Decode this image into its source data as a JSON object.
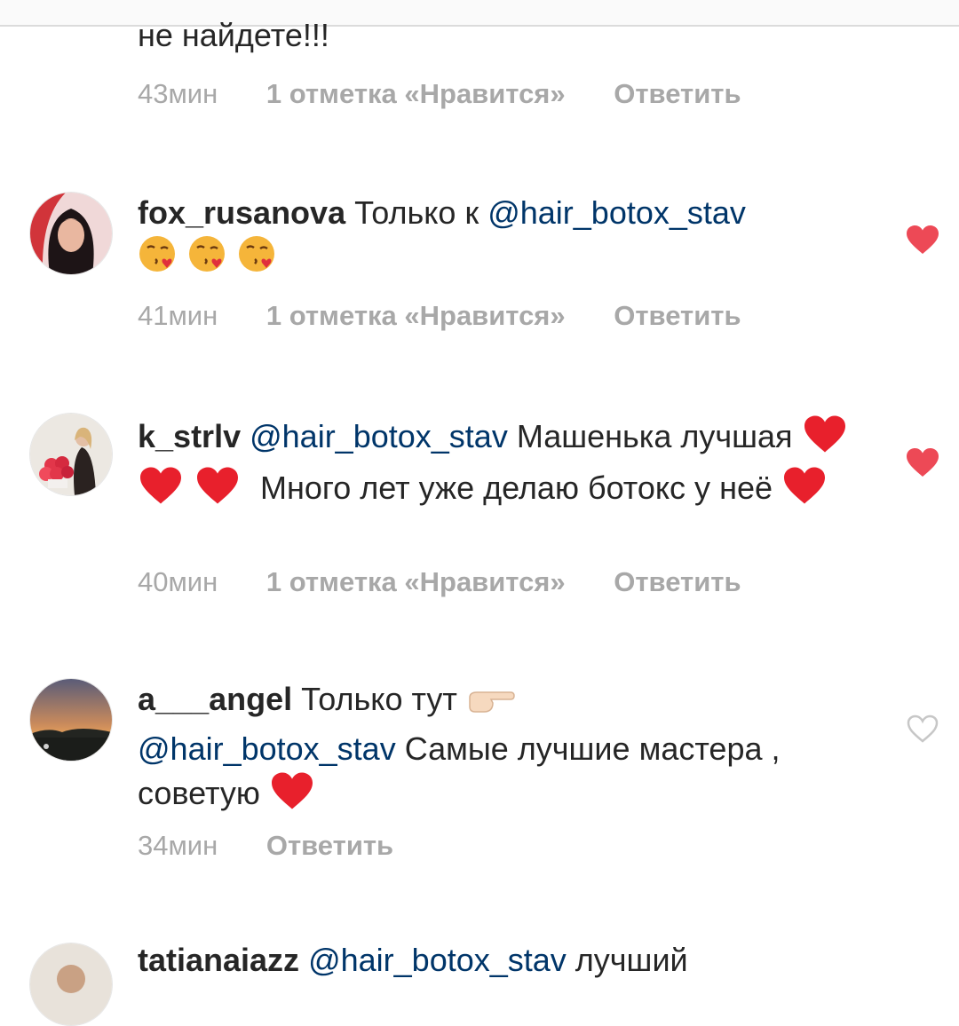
{
  "colors": {
    "mention": "#003569",
    "meta": "#a8a8a8",
    "liked_heart": "#ed4956"
  },
  "partial_comment": {
    "text": "не найдете!!!",
    "time": "43мин",
    "likes": "1 отметка «Нравится»",
    "reply": "Ответить"
  },
  "comments": [
    {
      "username": "fox_rusanova",
      "text_before": " Только к ",
      "mention": "@hair_botox_stav",
      "emojis": [
        "kissing-heart-emoji",
        "kissing-heart-emoji",
        "kissing-heart-emoji"
      ],
      "time": "41мин",
      "likes": "1 отметка «Нравится»",
      "reply": "Ответить",
      "liked": true
    },
    {
      "username": "k_strlv",
      "mention": "@hair_botox_stav",
      "text_1": " Машенька лучшая ",
      "text_2": " Много лет уже делаю ботокс у неё ",
      "emojis": [
        "red-heart-emoji",
        "red-heart-emoji",
        "red-heart-emoji",
        "red-heart-emoji"
      ],
      "time": "40мин",
      "likes": "1 отметка «Нравится»",
      "reply": "Ответить",
      "liked": true
    },
    {
      "username": "a___angel",
      "text_before": " Только тут ",
      "mention": "@hair_botox_stav",
      "text_after": " Самые лучшие мастера , советую ",
      "emojis": [
        "pointing-hand-emoji",
        "red-heart-emoji"
      ],
      "time": "34мин",
      "reply": "Ответить",
      "liked": false
    },
    {
      "username": "tatianaiazz",
      "mention": "@hair_botox_stav",
      "text_after": " лучший"
    }
  ]
}
